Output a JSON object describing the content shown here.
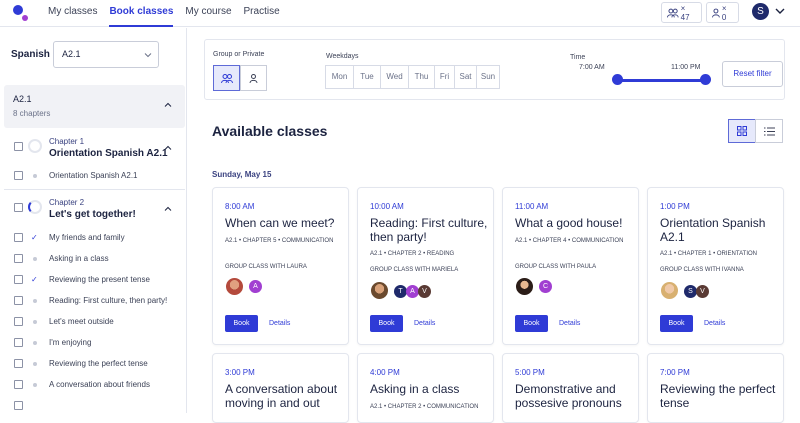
{
  "nav": {
    "items": [
      "My classes",
      "Book classes",
      "My course",
      "Practise"
    ]
  },
  "top": {
    "group_count": "× 47",
    "private_count": "× 0",
    "avatar": "S"
  },
  "sidebar": {
    "language_label": "Spanish",
    "level_value": "A2.1",
    "level_title": "A2.1",
    "level_subtitle": "8 chapters",
    "chapters": [
      {
        "label": "Chapter 1",
        "title": "Orientation Spanish A2.1",
        "lessons": [
          "Orientation Spanish A2.1"
        ]
      },
      {
        "label": "Chapter 2",
        "title": "Let's get together!",
        "lessons": [
          "My friends and family",
          "Asking in a class",
          "Reviewing the present tense",
          "Reading: First culture, then party!",
          "Let's meet outside",
          "I'm enjoying",
          "Reviewing the perfect tense",
          "A conversation about friends"
        ]
      }
    ]
  },
  "filter": {
    "type_label": "Group or Private",
    "weekdays_label": "Weekdays",
    "weekdays": [
      "Mon",
      "Tue",
      "Wed",
      "Thu",
      "Fri",
      "Sat",
      "Sun"
    ],
    "time_label": "Time",
    "time_start": "7:00 AM",
    "time_end": "11:00 PM",
    "reset_label": "Reset filter"
  },
  "main": {
    "heading": "Available classes",
    "date": "Sunday, May 15"
  },
  "cards": [
    {
      "time": "8:00 AM",
      "title": "When can we meet?",
      "meta": "A2.1 • CHAPTER 5 • COMMUNICATION",
      "with": "GROUP CLASS WITH LAURA",
      "pills": [
        {
          "letter": "A",
          "color": "#a13fd1"
        }
      ],
      "book": "Book",
      "details": "Details"
    },
    {
      "time": "10:00 AM",
      "title": "Reading: First culture, then party!",
      "meta": "A2.1 • CHAPTER 2 • READING",
      "with": "GROUP CLASS WITH MARIELA",
      "pills": [
        {
          "letter": "T",
          "color": "#1f2a6b"
        },
        {
          "letter": "A",
          "color": "#a13fd1"
        },
        {
          "letter": "V",
          "color": "#5a3a34"
        }
      ],
      "book": "Book",
      "details": "Details"
    },
    {
      "time": "11:00 AM",
      "title": "What a good house!",
      "meta": "A2.1 • CHAPTER 4 • COMMUNICATION",
      "with": "GROUP CLASS WITH PAULA",
      "pills": [
        {
          "letter": "C",
          "color": "#a13fd1"
        }
      ],
      "book": "Book",
      "details": "Details"
    },
    {
      "time": "1:00 PM",
      "title": "Orientation Spanish A2.1",
      "meta": "A2.1 • CHAPTER 1 • ORIENTATION",
      "with": "GROUP CLASS WITH IVANNA",
      "pills": [
        {
          "letter": "S",
          "color": "#1f2a6b"
        },
        {
          "letter": "V",
          "color": "#5a3a34"
        }
      ],
      "book": "Book",
      "details": "Details"
    },
    {
      "time": "3:00 PM",
      "title": "A conversation about moving in and out"
    },
    {
      "time": "4:00 PM",
      "title": "Asking in a class",
      "meta": "A2.1 • CHAPTER 2 • COMMUNICATION"
    },
    {
      "time": "5:00 PM",
      "title": "Demonstrative and possesive pronouns"
    },
    {
      "time": "7:00 PM",
      "title": "Reviewing the perfect tense"
    }
  ]
}
